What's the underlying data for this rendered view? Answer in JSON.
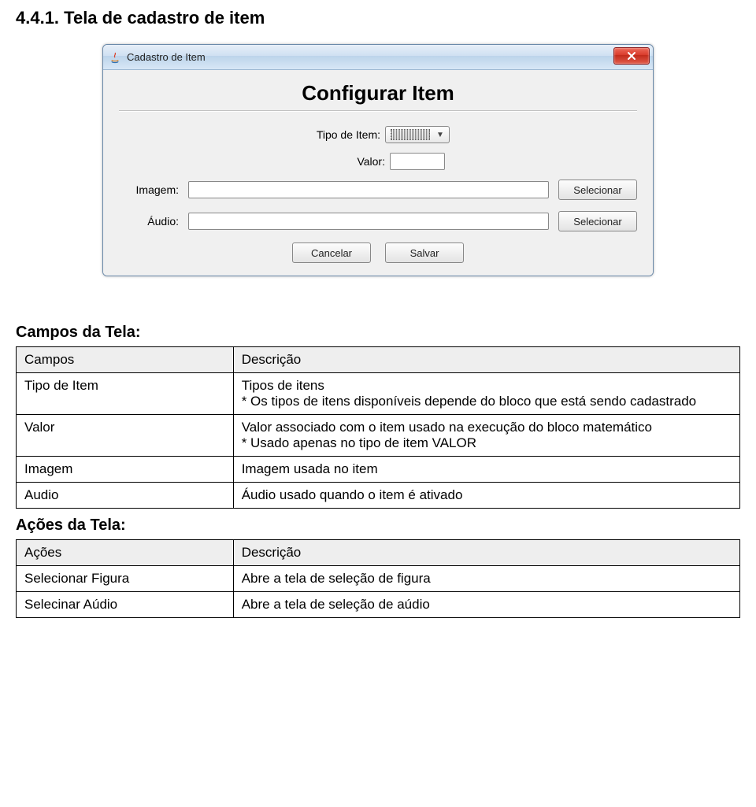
{
  "section_heading": "4.4.1. Tela de cadastro de item",
  "dialog": {
    "window_title": "Cadastro de Item",
    "heading": "Configurar Item",
    "labels": {
      "tipo": "Tipo de Item:",
      "valor": "Valor:",
      "imagem": "Imagem:",
      "audio": "Áudio:"
    },
    "buttons": {
      "selecionar_imagem": "Selecionar",
      "selecionar_audio": "Selecionar",
      "cancelar": "Cancelar",
      "salvar": "Salvar"
    }
  },
  "campos_table": {
    "title": "Campos da Tela:",
    "head_col1": "Campos",
    "head_col2": "Descrição",
    "rows": [
      {
        "c1": "Tipo de Item",
        "c2": "Tipos de itens\n* Os tipos de itens disponíveis depende do bloco que está sendo cadastrado"
      },
      {
        "c1": "Valor",
        "c2": "Valor associado com o item usado na execução do bloco matemático\n* Usado apenas no tipo de item VALOR"
      },
      {
        "c1": "Imagem",
        "c2": "Imagem usada no item"
      },
      {
        "c1": "Audio",
        "c2": "Áudio usado quando o item é ativado"
      }
    ]
  },
  "acoes_table": {
    "title": "Ações da Tela:",
    "head_col1": "Ações",
    "head_col2": "Descrição",
    "rows": [
      {
        "c1": "Selecionar Figura",
        "c2": "Abre a tela de seleção de figura"
      },
      {
        "c1": "Selecinar Aúdio",
        "c2": "Abre a tela de seleção de aúdio"
      }
    ]
  }
}
